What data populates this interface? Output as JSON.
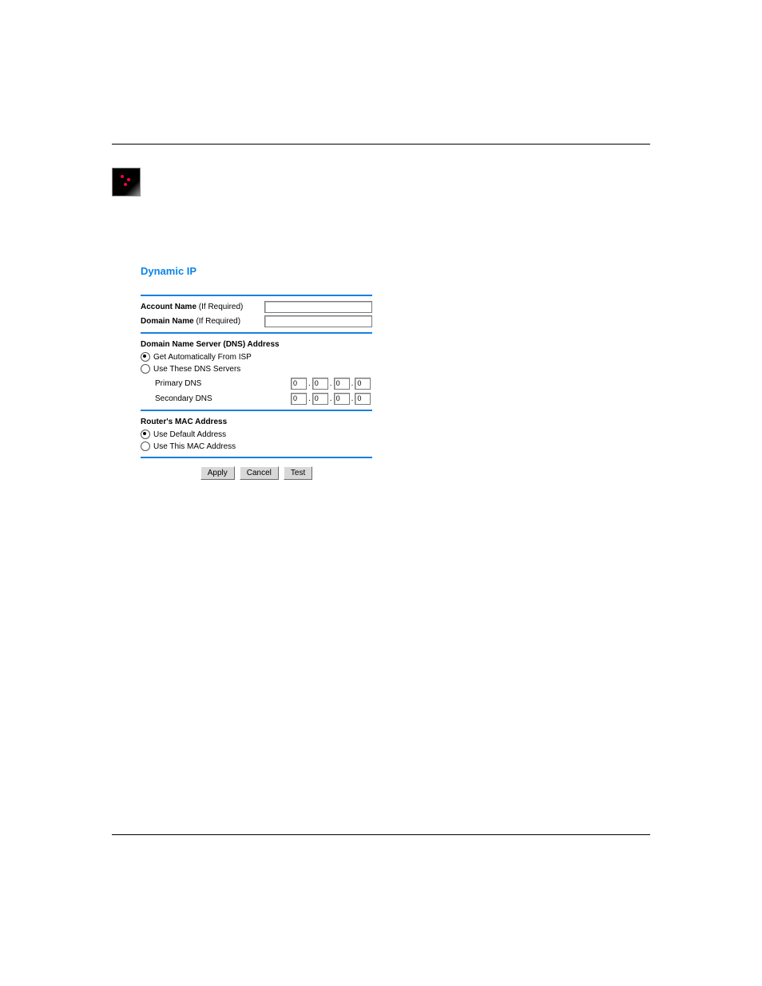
{
  "form": {
    "title": "Dynamic IP",
    "account": {
      "label_bold": "Account Name",
      "label_note": "(If Required)",
      "value": ""
    },
    "domain": {
      "label_bold": "Domain Name",
      "label_note": "(If Required)",
      "value": ""
    },
    "dns_section": {
      "heading": "Domain Name Server (DNS) Address",
      "auto_label": "Get Automatically From ISP",
      "use_these_label": "Use These DNS Servers",
      "selected": "auto",
      "primary_label": "Primary DNS",
      "secondary_label": "Secondary DNS",
      "primary_ip": [
        "0",
        "0",
        "0",
        "0"
      ],
      "secondary_ip": [
        "0",
        "0",
        "0",
        "0"
      ]
    },
    "mac_section": {
      "heading": "Router's MAC Address",
      "default_label": "Use Default Address",
      "this_label": "Use This MAC Address",
      "selected": "default"
    },
    "buttons": {
      "apply": "Apply",
      "cancel": "Cancel",
      "test": "Test"
    }
  }
}
